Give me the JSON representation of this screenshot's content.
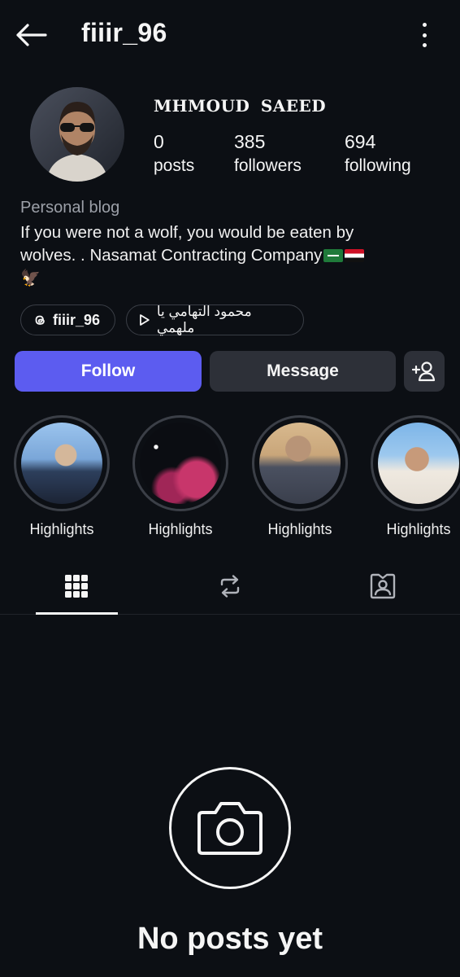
{
  "header": {
    "username": "fiiir_96",
    "back_icon": "arrow-left-icon",
    "more_icon": "more-vertical-icon"
  },
  "profile": {
    "display_name": "MHMOUD SAEED",
    "stats": {
      "posts": {
        "value": "0",
        "label": "posts"
      },
      "followers": {
        "value": "385",
        "label": "followers"
      },
      "following": {
        "value": "694",
        "label": "following"
      }
    },
    "category": "Personal blog",
    "bio": {
      "line1": "If you were not a wolf, you would be eaten by",
      "line2": "wolves.         . Nasamat Contracting Company",
      "line3": "🦅"
    }
  },
  "chips": {
    "threads": "fiiir_96",
    "music": "محمود التهامي يا ملهمي"
  },
  "buttons": {
    "follow": "Follow",
    "message": "Message",
    "add_user_icon": "add-user-icon"
  },
  "highlights": [
    {
      "label": "Highlights"
    },
    {
      "label": "Highlights"
    },
    {
      "label": "Highlights"
    },
    {
      "label": "Highlights"
    }
  ],
  "tabs": [
    {
      "icon": "grid-icon",
      "active": true
    },
    {
      "icon": "reposts-icon",
      "active": false
    },
    {
      "icon": "tagged-icon",
      "active": false
    }
  ],
  "empty_state": {
    "icon": "camera-icon",
    "text": "No posts yet"
  },
  "colors": {
    "background": "#0c0f14",
    "follow_button": "#5c5cf0",
    "secondary_button": "#2d3038"
  }
}
